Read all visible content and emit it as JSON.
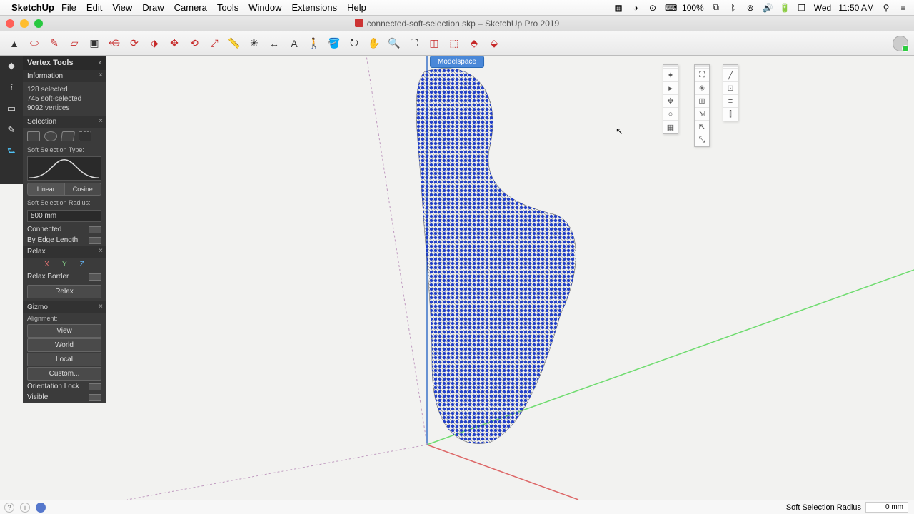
{
  "app_name": "SketchUp",
  "menus": [
    "File",
    "Edit",
    "View",
    "Draw",
    "Camera",
    "Tools",
    "Window",
    "Extensions",
    "Help"
  ],
  "mac_right": {
    "zoom": "100%",
    "day": "Wed",
    "time": "11:50 AM"
  },
  "document_title": "connected-soft-selection.skp – SketchUp Pro 2019",
  "modelspace_label": "Modelspace",
  "panel_title": "Vertex Tools",
  "information": {
    "header": "Information",
    "line1": "128 selected",
    "line2": "745 soft-selected",
    "line3": "9092 vertices"
  },
  "selection": {
    "header": "Selection",
    "soft_type_label": "Soft Selection Type:",
    "linear": "Linear",
    "cosine": "Cosine",
    "radius_label": "Soft Selection Radius:",
    "radius_value": "500 mm",
    "connected": "Connected",
    "by_edge": "By Edge Length"
  },
  "relax": {
    "header": "Relax",
    "x": "X",
    "y": "Y",
    "z": "Z",
    "border": "Relax Border",
    "button": "Relax"
  },
  "gizmo": {
    "header": "Gizmo",
    "alignment_label": "Alignment:",
    "view": "View",
    "world": "World",
    "local": "Local",
    "custom": "Custom...",
    "orientation_lock": "Orientation Lock",
    "visible": "Visible"
  },
  "statusbar": {
    "label": "Soft Selection Radius",
    "value": "0 mm"
  },
  "toolbar_icons": [
    "select-tool",
    "eraser-tool",
    "line-tool",
    "shape-tool",
    "pushpull-tool",
    "followme-tool",
    "offset-tool",
    "outer-shell-tool",
    "move-tool",
    "rotate-tool",
    "scale-tool",
    "tape-tool",
    "dimension-tool",
    "text-tool",
    "paint-tool",
    "orbit-tool",
    "pan-tool",
    "zoom-tool",
    "zoom-extents-tool",
    "section-tool",
    "3dw-tool",
    "layers-tool",
    "outliner-tool"
  ],
  "palette_icons_a": [
    "vt-tool-1",
    "vt-tool-2",
    "vt-tool-3",
    "vt-tool-4",
    "vt-tool-5"
  ],
  "palette_icons_b": [
    "vt-gizmo-1",
    "vt-gizmo-2",
    "vt-gizmo-3",
    "vt-gizmo-4",
    "vt-gizmo-5",
    "vt-gizmo-6"
  ],
  "palette_icons_c": [
    "vt-edit-1",
    "vt-edit-2",
    "vt-edit-3",
    "vt-edit-4"
  ]
}
